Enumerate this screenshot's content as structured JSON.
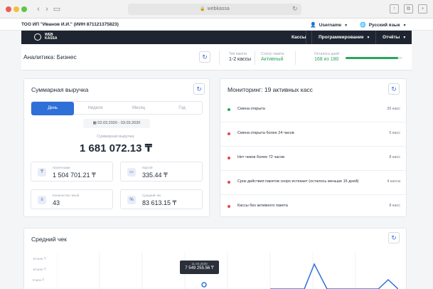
{
  "browser": {
    "url": "webkassa"
  },
  "top_header": {
    "company": "ТОО ИП \"Иванов И.И.\" (ИИН 871121375823)",
    "user": "Username",
    "language": "Русский язык"
  },
  "navbar": {
    "logo_line1": "WEB",
    "logo_line2": "KASSA",
    "items": [
      "Кассы",
      "Программирование",
      "Отчёты"
    ]
  },
  "sub_header": {
    "title": "Аналитика: Бизнес",
    "package_type_label": "Тип пакета",
    "package_type_value": "1-2 кассы",
    "package_status_label": "Статус пакета",
    "package_status_value": "Активный",
    "days_left_label": "Осталось дней",
    "days_left_value": "168 из 180",
    "days_progress": 0.93
  },
  "revenue": {
    "title": "Суммарная выручка",
    "tabs": [
      "День",
      "Неделя",
      "Месяц",
      "Год"
    ],
    "active_tab": "День",
    "date_range": "02.03.2020 - 03.03.2020",
    "total_label": "Суммарная выручка:",
    "total_value": "1 681 072.13 ₸",
    "cash_label": "Наличными",
    "cash_value": "1 504 701.21 ₸",
    "card_label": "Картой",
    "card_value": "335.44 ₸",
    "checks_label": "Количество чеков",
    "checks_value": "43",
    "avg_label": "Средний чек",
    "avg_value": "83 613.15 ₸"
  },
  "monitoring": {
    "title": "Мониторинг: 19 активных касс",
    "rows": [
      {
        "label": "Смена открыта",
        "count": "35 касс",
        "color": "#2aa65d"
      },
      {
        "label": "Смена открыта более 24 часов",
        "count": "5 касс",
        "color": "#e0474c"
      },
      {
        "label": "Нет чеков более 72 часов",
        "count": "8 касс",
        "color": "#e0474c"
      },
      {
        "label": "Срок действия пакетов скоро истекает (осталось меньше 15 дней)",
        "count": "4 касса",
        "color": "#e0474c"
      },
      {
        "label": "Кассы без активного пакета",
        "count": "8 касс",
        "color": "#e0474c"
      }
    ]
  },
  "avg_check_chart": {
    "title": "Средний чек",
    "y_ticks": [
      "10 млн ₸",
      "10 млн ₸",
      "8 млн ₸"
    ],
    "tooltip_date": "11.03.2020",
    "tooltip_value": "7 549 255.56 ₸",
    "accent_color": "#2f6fd8"
  }
}
